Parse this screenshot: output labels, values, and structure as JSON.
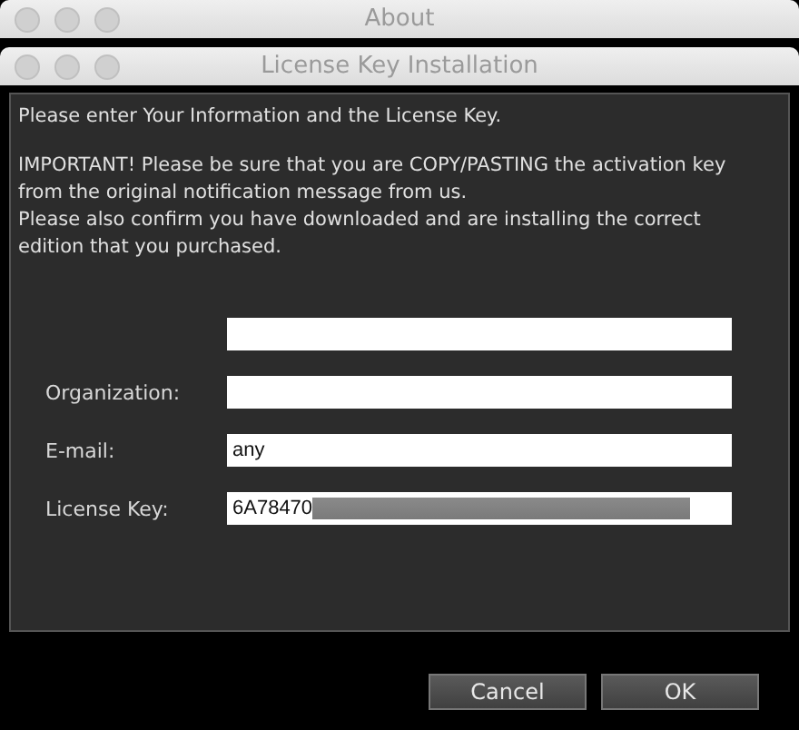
{
  "background_window": {
    "title": "About"
  },
  "window": {
    "title": "License Key Installation"
  },
  "intro": "Please enter Your Information and the License Key.",
  "notice": [
    "IMPORTANT! Please be sure that you are COPY/PASTING the activation key",
    "from the original notification message from us.",
    "Please also confirm you have downloaded and are installing the correct",
    "edition that you purchased."
  ],
  "fields": [
    {
      "kind": "text"
    },
    {
      "kind": "text",
      "label": "Organization:"
    },
    {
      "kind": "text",
      "label": "E-mail:",
      "value": "any"
    },
    {
      "kind": "text",
      "label": "License Key:",
      "value": "6A78470",
      "redacted": true
    }
  ],
  "buttons": [
    {
      "label": "Cancel"
    },
    {
      "label": "OK"
    }
  ]
}
